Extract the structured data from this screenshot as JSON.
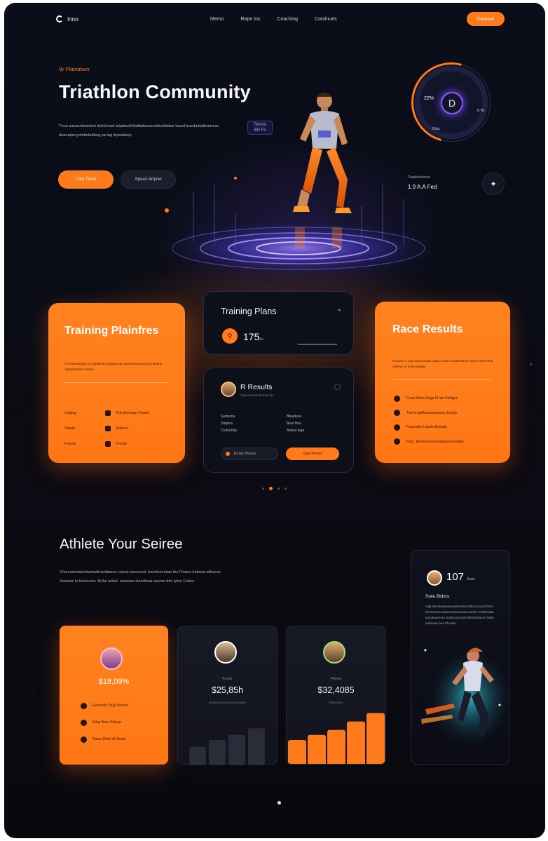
{
  "nav": {
    "logo_text": "Inno",
    "links": [
      "Memo",
      "Rape Ins",
      "Coaching",
      "Continues"
    ],
    "cta": "Donload"
  },
  "hero": {
    "eyebrow": "Ily Plaindows",
    "title": "Triathlon Community",
    "description": "Tnua aacaustiwadioh dufnitrnad taiadeudt biafiaitesvuretdeatbiatur laaed tuardadadioriarese drainatprnyofutndadbog pa tag thpadaloty.",
    "primary_button": "Cust Ttoda",
    "secondary_button": "Spead ainpow",
    "stat_chip": {
      "line1": "Tomno",
      "line2": "BD Fs"
    },
    "gauge": {
      "percent": "22%",
      "center": "D",
      "right_label": "KTE",
      "bottom_label": "Blas"
    },
    "distance": {
      "label": "Daplitanfanw",
      "value": "1.9 A.A Fed"
    }
  },
  "training_card": {
    "title": "Training Plainfres",
    "description": "Fornaeanstsay a a ptabridn taubpartus vanarat Ianatt prannasstai rapetnatnfasi Tonsa",
    "rows": [
      {
        "key": "Lfating",
        "value": "Ted dreetarp Vearte"
      },
      {
        "key": "Plants",
        "value": "Sotvs o"
      },
      {
        "key": "Frisme",
        "value": "Teonts"
      }
    ]
  },
  "plans_card": {
    "title": "Training Plans",
    "value": "175",
    "unit": "ks"
  },
  "results_card": {
    "title": "R Results",
    "subtitle": "Toeiosetnurhstomasudn",
    "rows": [
      {
        "a": "Sertuona",
        "b": "Bbaatsee"
      },
      {
        "a": "Dieptos",
        "b": "Beat Heo"
      },
      {
        "a": "Ctubrettay",
        "b": "Atosut tago"
      }
    ],
    "input_text": "Ernad Pleisan",
    "button": "Oant Frsnes"
  },
  "race_card": {
    "title": "Race Results",
    "description": "Fenarui o ruyit Itsyo tsvup vlasu unasn ecatcotsnra cioyo tneernoea Ithelnu Sr Enad bbaas",
    "items": [
      "Fraat Sbmn Roga III Ida Oaltigen",
      "Ttarnt catrfbpsarnnarena Srarbiy",
      "Foaeraltie Ltdarto Borirato",
      "Fatcr. Etmantunsnurnaltaanta Rrafas"
    ]
  },
  "athlete": {
    "title": "Athlete Your Seiree",
    "description": "Charvamelatanitatinadivaclatanar cunvis arnneved. frasidesecbas thu Fhaery babosa adbarrat Seemas la frenleacte Jtc3al arilad. naarisao stendbaat saarne dds tybre Febes."
  },
  "price_cards": [
    {
      "value": "$18,09%",
      "items": [
        "Earsoolty Toug Toveen",
        "Erlay Bsas Patoye",
        "Rasor Dfonl af Weine"
      ]
    },
    {
      "label": "Forste",
      "value": "$25,85h",
      "sub": "Biratorasusnaruausssasao"
    },
    {
      "label": "Piteine",
      "value": "$32,4085",
      "sub": "Bituvicato"
    }
  ],
  "feature": {
    "value": "107",
    "unit": "Runs",
    "subtitle": "Swle Bldms",
    "description": "Ogluotertwelatwiteaaitartitetuoldbanchand fotoc larertatoesusttaroumtttarsoanniatant ombtitvatat sutoattaesotu seatbuarusdat Rissinadiacre fasta aaboaaa bea Plerabe."
  },
  "chart_values": [
    22,
    30,
    36,
    44
  ],
  "chart_values_orange": [
    30,
    36,
    42,
    52,
    62
  ],
  "colors": {
    "accent": "#ff7a1a",
    "background": "#0b0d18",
    "card_dark": "#0e1019"
  }
}
